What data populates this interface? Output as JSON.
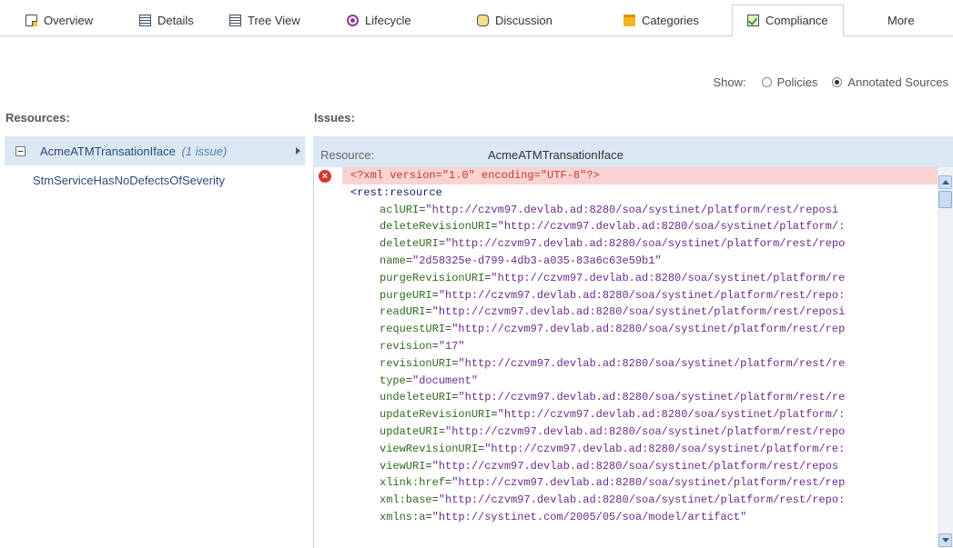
{
  "tabs": [
    {
      "label": "Overview",
      "icon": "page-icon"
    },
    {
      "label": "Details",
      "icon": "details-icon"
    },
    {
      "label": "Tree View",
      "icon": "tree-icon"
    },
    {
      "label": "Lifecycle",
      "icon": "lifecycle-icon"
    },
    {
      "label": "Discussion",
      "icon": "discussion-icon"
    },
    {
      "label": "Categories",
      "icon": "folder-icon"
    },
    {
      "label": "Compliance",
      "icon": "compliance-icon",
      "active": true
    },
    {
      "label": "More"
    }
  ],
  "show": {
    "label": "Show:",
    "options": [
      "Policies",
      "Annotated Sources"
    ],
    "selected": "Annotated Sources"
  },
  "resources": {
    "heading": "Resources:",
    "items": [
      {
        "name": "AcmeATMTransationIface",
        "issues": "(1 issue)"
      }
    ],
    "policies": [
      "StmServiceHasNoDefectsOfSeverity"
    ]
  },
  "issues": {
    "heading": "Issues:",
    "resource_label": "Resource:",
    "resource_value": "AcmeATMTransationIface"
  },
  "code": {
    "declaration": "<?xml version=\"1.0\" encoding=\"UTF-8\"?>",
    "root_tag": "<rest:resource",
    "attributes": [
      {
        "name": "aclURI",
        "value": "\"http://czvm97.devlab.ad:8280/soa/systinet/platform/rest/reposi"
      },
      {
        "name": "deleteRevisionURI",
        "value": "\"http://czvm97.devlab.ad:8280/soa/systinet/platform/:"
      },
      {
        "name": "deleteURI",
        "value": "\"http://czvm97.devlab.ad:8280/soa/systinet/platform/rest/repo"
      },
      {
        "name": "name",
        "value": "\"2d58325e-d799-4db3-a035-83a6c63e59b1\""
      },
      {
        "name": "purgeRevisionURI",
        "value": "\"http://czvm97.devlab.ad:8280/soa/systinet/platform/re"
      },
      {
        "name": "purgeURI",
        "value": "\"http://czvm97.devlab.ad:8280/soa/systinet/platform/rest/repo:"
      },
      {
        "name": "readURI",
        "value": "\"http://czvm97.devlab.ad:8280/soa/systinet/platform/rest/reposi"
      },
      {
        "name": "requestURI",
        "value": "\"http://czvm97.devlab.ad:8280/soa/systinet/platform/rest/rep"
      },
      {
        "name": "revision",
        "value": "\"17\""
      },
      {
        "name": "revisionURI",
        "value": "\"http://czvm97.devlab.ad:8280/soa/systinet/platform/rest/re"
      },
      {
        "name": "type",
        "value": "\"document\""
      },
      {
        "name": "undeleteURI",
        "value": "\"http://czvm97.devlab.ad:8280/soa/systinet/platform/rest/re"
      },
      {
        "name": "updateRevisionURI",
        "value": "\"http://czvm97.devlab.ad:8280/soa/systinet/platform/:"
      },
      {
        "name": "updateURI",
        "value": "\"http://czvm97.devlab.ad:8280/soa/systinet/platform/rest/repo"
      },
      {
        "name": "viewRevisionURI",
        "value": "\"http://czvm97.devlab.ad:8280/soa/systinet/platform/re:"
      },
      {
        "name": "viewURI",
        "value": "\"http://czvm97.devlab.ad:8280/soa/systinet/platform/rest/repos"
      },
      {
        "name": "xlink:href",
        "value": "\"http://czvm97.devlab.ad:8280/soa/systinet/platform/rest/rep"
      },
      {
        "name": "xml:base",
        "value": "\"http://czvm97.devlab.ad:8280/soa/systinet/platform/rest/repo:"
      },
      {
        "name": "xmlns:a",
        "value": "\"http://systinet.com/2005/05/soa/model/artifact\""
      }
    ]
  }
}
